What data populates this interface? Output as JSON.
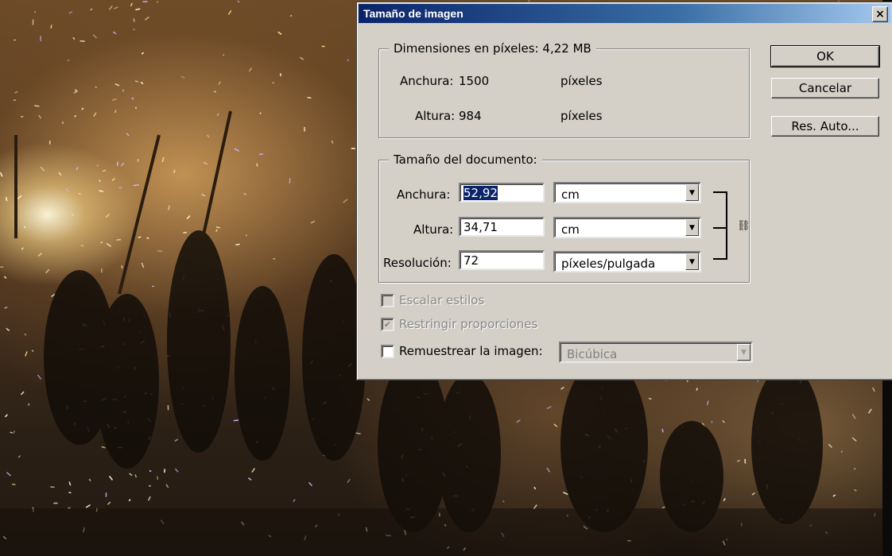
{
  "dialog": {
    "title": "Tamaño de imagen",
    "close_glyph": "×"
  },
  "pixel_dimensions": {
    "legend": "Dimensiones en píxeles: 4,22 MB",
    "width_label": "Anchura:",
    "width_value": "1500",
    "width_unit": "píxeles",
    "height_label": "Altura:",
    "height_value": "984",
    "height_unit": "píxeles"
  },
  "document_size": {
    "legend": "Tamaño del documento:",
    "width_label": "Anchura:",
    "width_value": "52,92",
    "width_unit": "cm",
    "height_label": "Altura:",
    "height_value": "34,71",
    "height_unit": "cm",
    "resolution_label": "Resolución:",
    "resolution_value": "72",
    "resolution_unit": "píxeles/pulgada",
    "link_icon": "chain-link-icon"
  },
  "options": {
    "scale_styles_label": "Escalar estilos",
    "scale_styles_checked": false,
    "constrain_label": "Restringir proporciones",
    "constrain_checked": true,
    "resample_label": "Remuestrear la imagen:",
    "resample_checked": false,
    "resample_method": "Bicúbica"
  },
  "buttons": {
    "ok": "OK",
    "cancel": "Cancelar",
    "auto": "Res. Auto..."
  },
  "colors": {
    "titlebar_start": "#0a246a",
    "titlebar_end": "#a6caf0",
    "dialog_bg": "#d4d0c8",
    "selection": "#0a246a"
  }
}
